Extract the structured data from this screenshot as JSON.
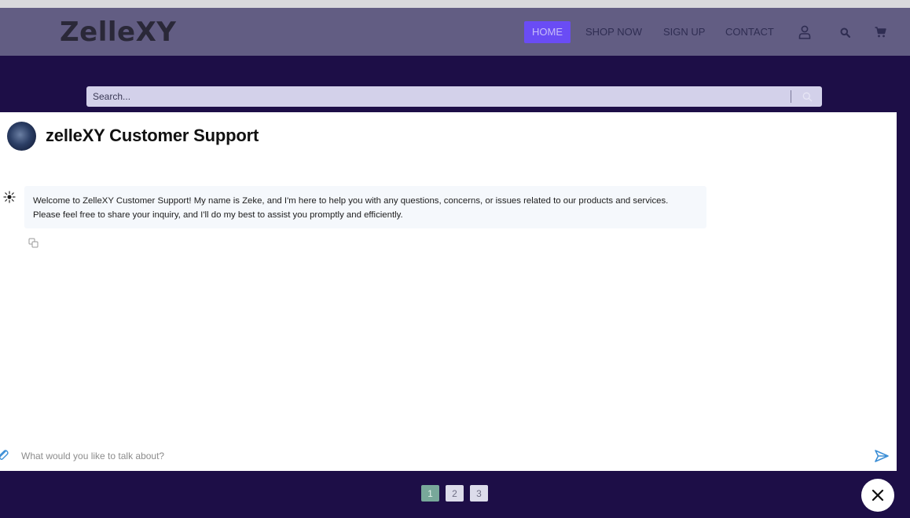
{
  "brand": {
    "logo_text": "ZelleXY"
  },
  "nav": {
    "items": [
      {
        "label": "HOME",
        "active": true
      },
      {
        "label": "SHOP NOW",
        "active": false
      },
      {
        "label": "SIGN UP",
        "active": false
      },
      {
        "label": "CONTACT",
        "active": false
      }
    ],
    "icons": [
      "user-icon",
      "search-icon",
      "cart-icon"
    ]
  },
  "search": {
    "placeholder": "Search..."
  },
  "chat": {
    "title": "zelleXY Customer Support",
    "messages": [
      {
        "sender": "bot",
        "text": "Welcome to ZelleXY Customer Support! My name is Zeke, and I'm here to help you with any questions, concerns, or issues related to our products and services. Please feel free to share your inquiry, and I'll do my best to assist you promptly and efficiently."
      }
    ],
    "input_placeholder": "What would you like to talk about?"
  },
  "pagination": {
    "pages": [
      "1",
      "2",
      "3"
    ],
    "current": "1"
  },
  "colors": {
    "page_background": "#1d0e47",
    "navbar": "#625d83",
    "nav_active": "#6a4cf5",
    "send_accent": "#3d8fd6",
    "page_active": "#78a89a"
  }
}
